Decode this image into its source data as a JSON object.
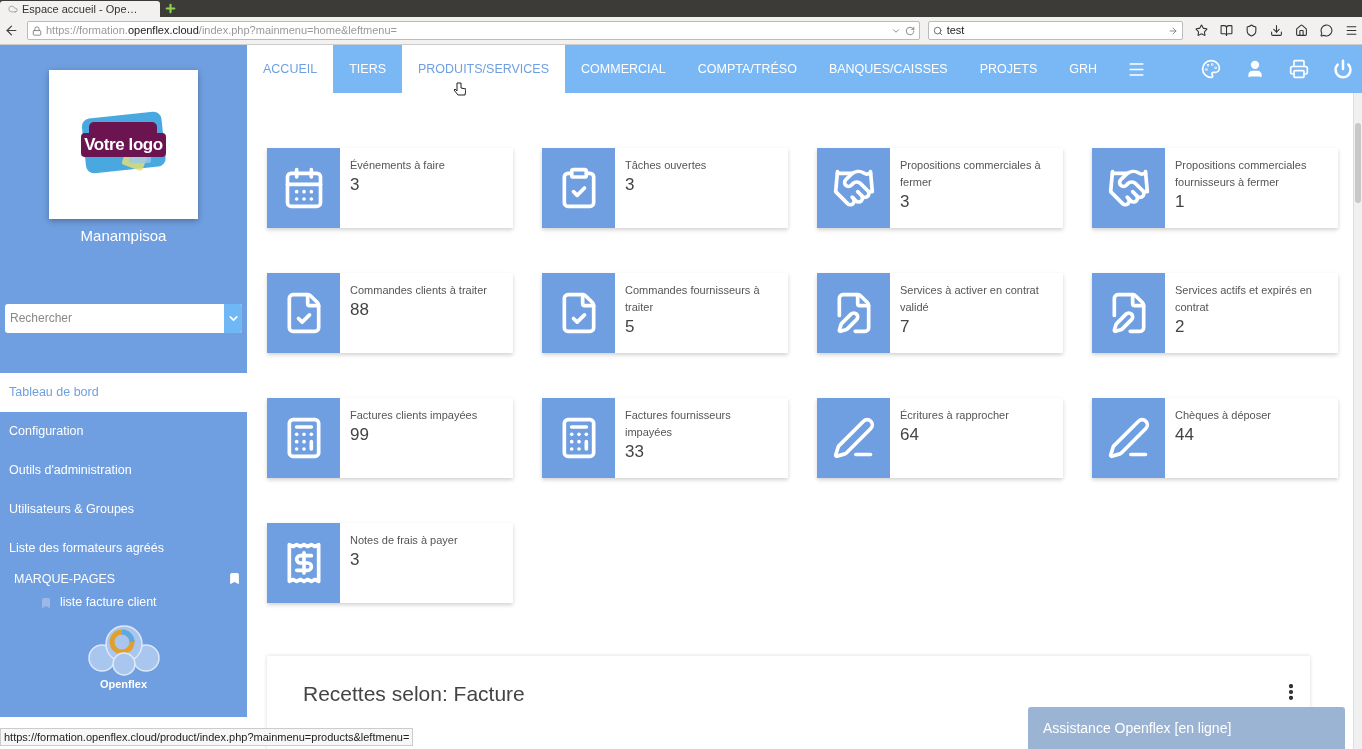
{
  "browser": {
    "tab_title": "Espace accueil - Ope…",
    "url_host_prefix": "https://formation.",
    "url_host": "openflex.cloud",
    "url_path": "/index.php?mainmenu=home&leftmenu=",
    "search_value": "test"
  },
  "sidebar": {
    "logo_text": "Votre logo",
    "user_name": "Manampisoa",
    "search": {
      "placeholder": "Rechercher"
    },
    "menu": [
      {
        "label": "Tableau de bord",
        "selected": true
      },
      {
        "label": "Configuration",
        "selected": false
      },
      {
        "label": "Outils d'administration",
        "selected": false
      },
      {
        "label": "Utilisateurs & Groupes",
        "selected": false
      },
      {
        "label": "Liste des formateurs agréés",
        "selected": false
      }
    ],
    "bookmarks": {
      "title": "MARQUE-PAGES",
      "items": [
        "liste facture client"
      ]
    },
    "brand": "Openflex"
  },
  "nav": {
    "tabs": [
      {
        "label": "ACCUEIL",
        "selected": true
      },
      {
        "label": "TIERS",
        "selected": false
      },
      {
        "label": "PRODUITS/SERVICES",
        "selected": true
      },
      {
        "label": "COMMERCIAL",
        "selected": false
      },
      {
        "label": "COMPTA/TRÉSO",
        "selected": false
      },
      {
        "label": "BANQUES/CAISSES",
        "selected": false
      },
      {
        "label": "PROJETS",
        "selected": false
      },
      {
        "label": "GRH",
        "selected": false
      }
    ]
  },
  "cards": [
    {
      "kind": "calendar",
      "label": "Événements à faire",
      "value": "3"
    },
    {
      "kind": "tasks",
      "label": "Tâches ouvertes",
      "value": "3"
    },
    {
      "kind": "handshake",
      "label": "Propositions commerciales à fermer",
      "value": "3"
    },
    {
      "kind": "handshake",
      "label": "Propositions commerciales fournisseurs à fermer",
      "value": "1"
    },
    {
      "kind": "order",
      "label": "Commandes clients à traiter",
      "value": "88"
    },
    {
      "kind": "order",
      "label": "Commandes fournisseurs à traiter",
      "value": "5"
    },
    {
      "kind": "contract",
      "label": "Services à activer en contrat validé",
      "value": "7"
    },
    {
      "kind": "contract",
      "label": "Services actifs et expirés en contrat",
      "value": "2"
    },
    {
      "kind": "invoice",
      "label": "Factures clients impayées",
      "value": "99"
    },
    {
      "kind": "invoice",
      "label": "Factures fournisseurs impayées",
      "value": "33"
    },
    {
      "kind": "cheque",
      "label": "Écritures à rapprocher",
      "value": "64"
    },
    {
      "kind": "cheque",
      "label": "Chèques à déposer",
      "value": "44"
    },
    {
      "kind": "expense",
      "label": "Notes de frais à payer",
      "value": "3"
    }
  ],
  "panel": {
    "title": "Recettes selon: Facture"
  },
  "chat": {
    "label": "Assistance Openflex [en ligne]"
  },
  "status_bar": "https://formation.openflex.cloud/product/index.php?mainmenu=products&leftmenu="
}
